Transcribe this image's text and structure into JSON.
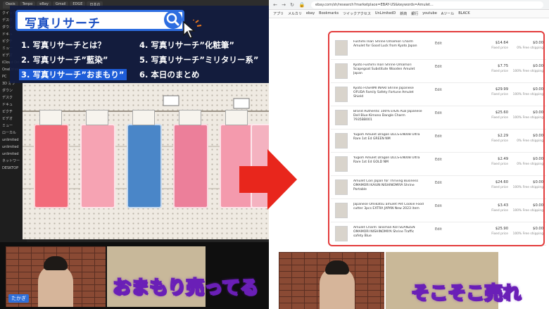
{
  "left": {
    "tabs": [
      "Oasis",
      "Tenpo",
      "eBay",
      "Gmail",
      "EDGE",
      "日本の"
    ],
    "sidebar": [
      "クイック",
      "デスク",
      "ダウン",
      "ドキュ",
      "ピクチ",
      "ミュー",
      "ビデオ",
      "iCloud Dri",
      "OneDrive",
      "PC",
      "3D オブ",
      "ダウン",
      "デスク",
      "ドキュ",
      "ピクチ",
      "ビデオ",
      "ミュー",
      "ローカル",
      "unlimited",
      "unlimited",
      "unlimited",
      "ネットワー",
      "DESKTOP"
    ],
    "search_title": "写真リサーチ",
    "toc": [
      {
        "text": "1. 写真リサーチとは？",
        "active": false
      },
      {
        "text": "4. 写真リサーチ”化粧筆”",
        "active": false
      },
      {
        "text": "2. 写真リサーチ”藍染”",
        "active": false
      },
      {
        "text": "5. 写真リサーチ”ミリタリー系”",
        "active": false
      },
      {
        "text": "3. 写真リサーチ”おまもり”",
        "active": true
      },
      {
        "text": "6. 本日のまとめ",
        "active": false
      }
    ],
    "caption": "おまもり売ってる",
    "speaker": "たかぎ"
  },
  "right": {
    "url": "ebay.com/sh/research?marketplace=EBAY-US&keywords=Amulet...",
    "bookmarks": [
      "アプリ",
      "メルカリ",
      "ebay",
      "Bookmarks",
      "ツイックアクセス",
      "UnLimitedD",
      "新商",
      "銀行",
      "youtube",
      "Aツール",
      "BLACK"
    ],
    "rows": [
      {
        "title": "Fushimi Inari Shrine Omamori Charm Amulet for Good Luck from Kyoto Japan",
        "edit": "Edit",
        "price": "$14.64",
        "ptype": "Fixed price",
        "price2": "$0.00",
        "ship": "0% Free shipping"
      },
      {
        "title": "Kyoto Fushimi Inari Shrine Omamori Scapegoat Substitute Wooden Amulet Japan",
        "edit": "Edit",
        "price": "$7.75",
        "ptype": "Fixed price",
        "price2": "$0.00",
        "ship": "100% Free shipping"
      },
      {
        "title": "Kyoto FUSHIMI INARI Shrine Japanese OFUDA Family Safety Fortune Amulet Shield",
        "edit": "Edit",
        "price": "$29.99",
        "ptype": "Fixed price",
        "price2": "$0.00",
        "ship": "100% Free shipping"
      },
      {
        "title": "Brand Authentic 100% E926 ALB Japanese Doll Blue Kimono Dangle Charm 7935BB001",
        "edit": "Edit",
        "price": "$25.60",
        "ptype": "Fixed price",
        "price2": "$0.00",
        "ship": "100% Free shipping"
      },
      {
        "title": "Yugioh Amulet Dragon DLCS-EN008 Ultra Rare 1st Ed GREEN NM",
        "edit": "Edit",
        "price": "$2.29",
        "ptype": "Fixed price",
        "price2": "$0.00",
        "ship": "0% Free shipping"
      },
      {
        "title": "Yugioh Amulet Dragon DLCS-EN008 Ultra Rare 1st Ed GOLD NM",
        "edit": "Edit",
        "price": "$2.49",
        "ptype": "Fixed price",
        "price2": "$0.00",
        "ship": "0% Free shipping"
      },
      {
        "title": "Amulet Coin Japan for Thriving Business OMAMORI KAIUN NISHINOMIYA Shrine Portable",
        "edit": "Edit",
        "price": "$24.60",
        "ptype": "Fixed price",
        "price2": "$0.00",
        "ship": "100% Free shipping"
      },
      {
        "title": "Japanese Omikatsu amulet Pet Cookie Food cutter 3pcs EXTRA JAPAN New 2023 item",
        "edit": "Edit",
        "price": "$3.43",
        "ptype": "Fixed price",
        "price2": "$0.00",
        "ship": "100% Free shipping"
      },
      {
        "title": "Amulet Charm Talisman KOTSUANZEN OMAMORI NISHINOMIYA Shrine Traffic safety Blue",
        "edit": "Edit",
        "price": "$25.90",
        "ptype": "Fixed price",
        "price2": "$0.00",
        "ship": "100% Free shipping"
      }
    ],
    "caption": "そこそこ売れ"
  },
  "colors": {
    "accent_blue": "#1e5dd8",
    "highlight_red": "#e33b3b",
    "caption_purple": "#6a1fb7",
    "arrow_red": "#e8261c"
  }
}
